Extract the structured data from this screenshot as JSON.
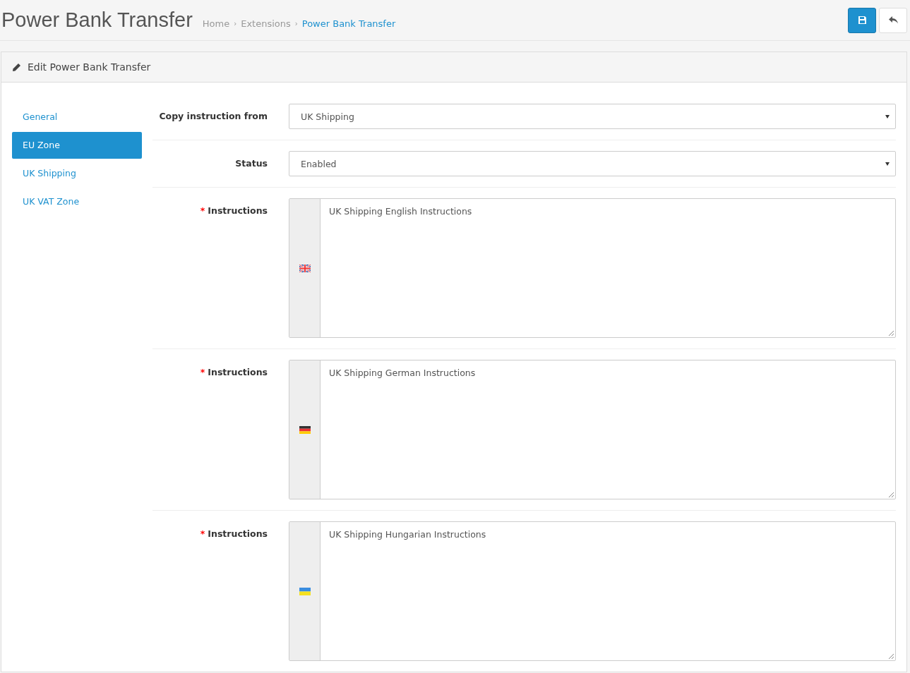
{
  "page_title": "Power Bank Transfer",
  "breadcrumb": [
    {
      "label": "Home",
      "current": false
    },
    {
      "separator": "›",
      "label": "Extensions",
      "current": false
    },
    {
      "separator": "›",
      "label": "Power Bank Transfer",
      "current": true
    }
  ],
  "header_buttons": [
    {
      "kind": "save"
    },
    {
      "kind": "back"
    }
  ],
  "panel": {
    "title": "Edit Power Bank Transfer"
  },
  "tabs": [
    {
      "label": "General",
      "selected": false
    },
    {
      "label": "EU Zone",
      "selected": true
    },
    {
      "label": "UK Shipping",
      "selected": false
    },
    {
      "label": "UK VAT Zone",
      "selected": false
    }
  ],
  "fields": [
    {
      "kind": "select",
      "label": "Copy instruction from",
      "value": "UK Shipping"
    },
    {
      "kind": "select",
      "label": "Status",
      "value": "Enabled"
    },
    {
      "kind": "textarea",
      "label": "Instructions",
      "required_mark": "*",
      "flag": {
        "kind": "uk"
      },
      "value": "UK Shipping English Instructions"
    },
    {
      "kind": "textarea",
      "label": "Instructions",
      "required_mark": "*",
      "flag": {
        "kind": "de"
      },
      "value": "UK Shipping German Instructions"
    },
    {
      "kind": "textarea",
      "label": "Instructions",
      "required_mark": "*",
      "flag": {
        "kind": "ua"
      },
      "value": "UK Shipping Hungarian Instructions"
    }
  ]
}
